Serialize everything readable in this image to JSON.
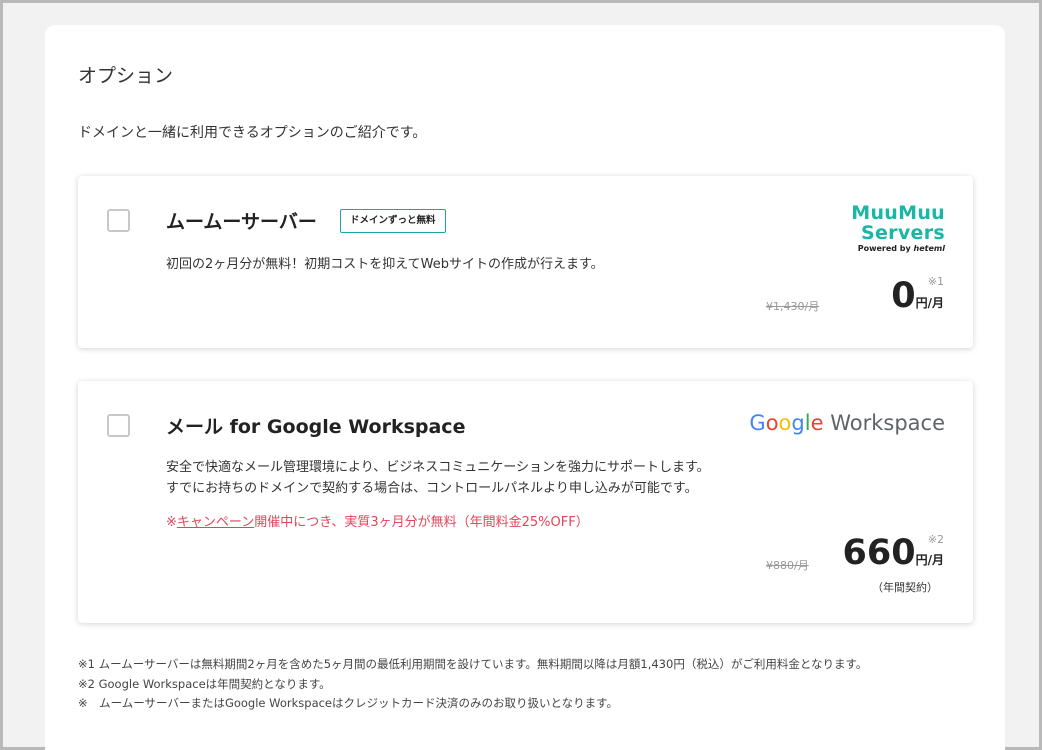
{
  "section": {
    "title": "オプション",
    "description": "ドメインと一緒に利用できるオプションのご紹介です。"
  },
  "options": [
    {
      "title": "ムームーサーバー",
      "badge": "ドメインずっと無料",
      "description": "初回の2ヶ月分が無料！初期コストを抑えてWebサイトの作成が行えます。",
      "logo_main": "MuuMuu Servers",
      "logo_sub_prefix": "Powered by ",
      "logo_sub_brand": "heteml",
      "old_price": "¥1,430/月",
      "note_mark": "※1",
      "price": "0",
      "price_unit": "円/月"
    },
    {
      "title": "メール for Google Workspace",
      "description_line1": "安全で快適なメール管理環境により、ビジネスコミュニケーションを強力にサポートします。",
      "description_line2": "すでにお持ちのドメインで契約する場合は、コントロールパネルより申し込みが可能です。",
      "campaign_prefix": "※",
      "campaign_link": "キャンペーン",
      "campaign_rest": "開催中につき、実質3ヶ月分が無料（年間料金25%OFF）",
      "logo_google_letters": [
        "G",
        "o",
        "o",
        "g",
        "l",
        "e"
      ],
      "logo_workspace": "Workspace",
      "old_price": "¥880/月",
      "note_mark": "※2",
      "price": "660",
      "price_unit": "円/月",
      "contract": "（年間契約）"
    }
  ],
  "footnotes": [
    "※1 ムームーサーバーは無料期間2ヶ月を含めた5ヶ月間の最低利用期間を設けています。無料期間以降は月額1,430円（税込）がご利用料金となります。",
    "※2 Google Workspaceは年間契約となります。",
    "※　ムームーサーバーまたはGoogle Workspaceはクレジットカード決済のみのお取り扱いとなります。"
  ],
  "colors": {
    "accent": "#1ab6a6",
    "campaign": "#e0455a",
    "google_blue": "#4285f4",
    "google_red": "#ea4335",
    "google_yellow": "#fbbc05",
    "google_green": "#34a853"
  }
}
